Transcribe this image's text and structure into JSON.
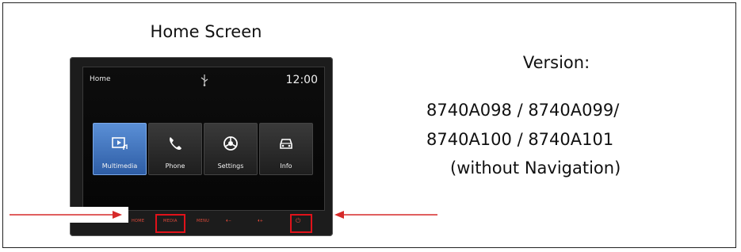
{
  "home_screen_title": "Home Screen",
  "version": {
    "title": "Version:",
    "lines": [
      "8740A098 / 8740A099/",
      "8740A100 / 8740A101",
      "(without Navigation)"
    ]
  },
  "device": {
    "status": {
      "title": "Home",
      "clock": "12:00",
      "usb_icon": "usb-icon"
    },
    "tiles": [
      {
        "label": "Multimedia",
        "icon": "multimedia-icon",
        "active": true
      },
      {
        "label": "Phone",
        "icon": "phone-icon",
        "active": false
      },
      {
        "label": "Settings",
        "icon": "settings-icon",
        "active": false
      },
      {
        "label": "Info",
        "icon": "car-icon",
        "active": false
      }
    ],
    "hardware_buttons": [
      "HOME",
      "MEDIA",
      "MENU",
      "⏴−",
      "⏴+",
      "⏻"
    ]
  },
  "colors": {
    "accent_red": "#e0121a",
    "tile_blue": "#3f72bd"
  }
}
